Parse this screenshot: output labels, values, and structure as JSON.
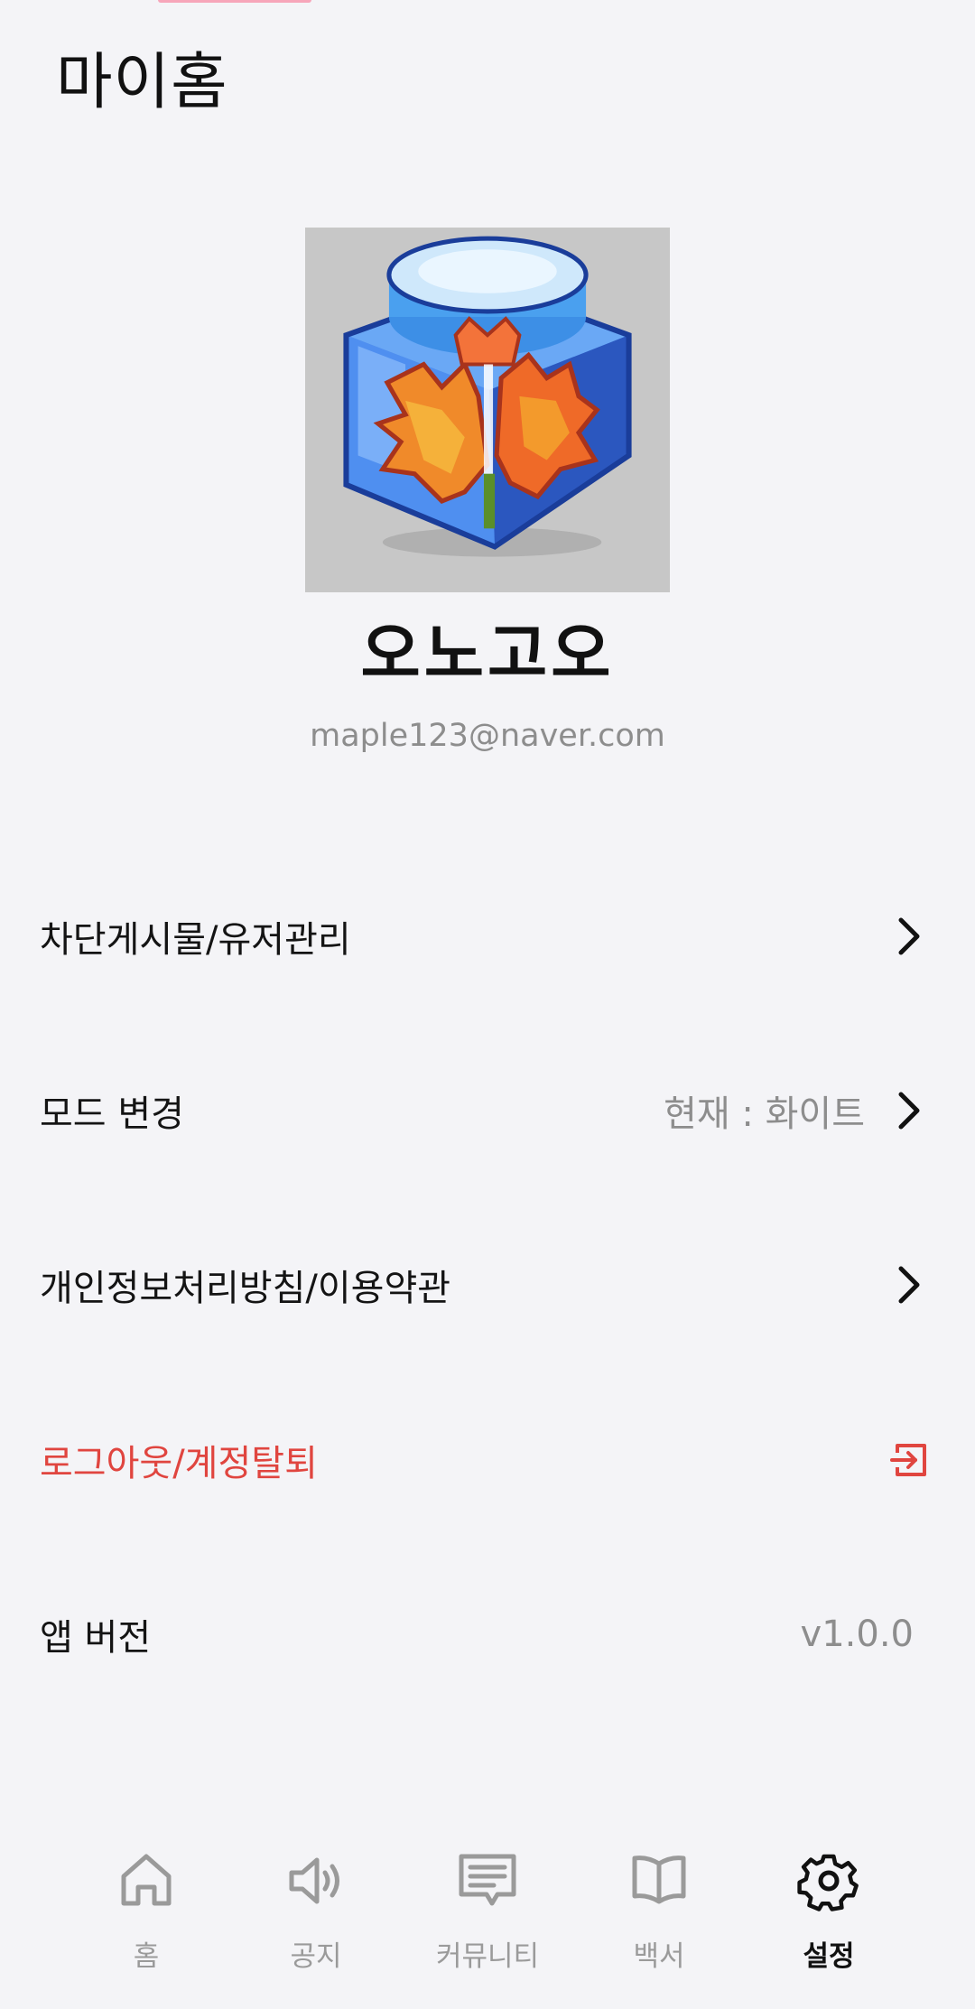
{
  "header": {
    "title": "마이홈"
  },
  "profile": {
    "nickname": "오노고오",
    "email": "maple123@naver.com",
    "avatar_icon": "maple-leaf-jar-icon"
  },
  "menu": {
    "block_manage": {
      "label": "차단게시물/유저관리"
    },
    "mode_change": {
      "label": "모드 변경",
      "value": "현재 : 화이트"
    },
    "privacy_terms": {
      "label": "개인정보처리방침/이용약관"
    },
    "logout": {
      "label": "로그아웃/계정탈퇴"
    },
    "app_version": {
      "label": "앱 버전",
      "value": "v1.0.0"
    }
  },
  "bottom_nav": {
    "items": [
      {
        "label": "홈",
        "icon": "home-icon"
      },
      {
        "label": "공지",
        "icon": "speaker-icon"
      },
      {
        "label": "커뮤니티",
        "icon": "chat-icon"
      },
      {
        "label": "백서",
        "icon": "book-icon"
      },
      {
        "label": "설정",
        "icon": "gear-icon"
      }
    ],
    "active_index": 4
  },
  "colors": {
    "background": "#f4f4f7",
    "danger": "#e0453f",
    "muted": "#8d8d8d",
    "nav_inactive": "#9a9a9a"
  }
}
